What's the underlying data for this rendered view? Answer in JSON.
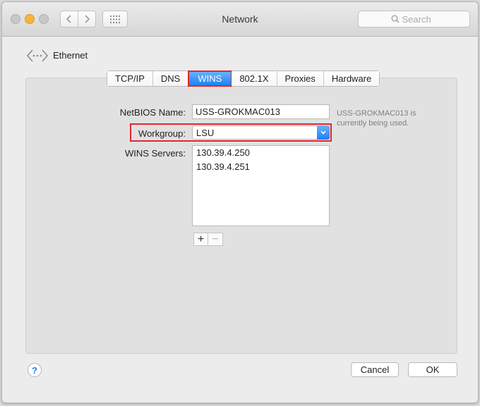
{
  "window": {
    "title": "Network",
    "search_placeholder": "Search"
  },
  "interface": {
    "name": "Ethernet",
    "icon": "ethernet-arrows-icon"
  },
  "tabs": [
    {
      "label": "TCP/IP",
      "active": false
    },
    {
      "label": "DNS",
      "active": false
    },
    {
      "label": "WINS",
      "active": true
    },
    {
      "label": "802.1X",
      "active": false
    },
    {
      "label": "Proxies",
      "active": false
    },
    {
      "label": "Hardware",
      "active": false
    }
  ],
  "form": {
    "netbios_label": "NetBIOS Name:",
    "netbios_value": "USS-GROKMAC013",
    "netbios_note_line1": "USS-GROKMAC013 is",
    "netbios_note_line2": "currently being used.",
    "workgroup_label": "Workgroup:",
    "workgroup_value": "LSU",
    "wins_label": "WINS Servers:",
    "wins_servers": [
      "130.39.4.250",
      "130.39.4.251"
    ],
    "add_symbol": "+",
    "remove_symbol": "−"
  },
  "footer": {
    "help_symbol": "?",
    "cancel_label": "Cancel",
    "ok_label": "OK"
  },
  "colors": {
    "accent": "#1a7ff5",
    "highlight": "#e0282e",
    "minimize": "#f5b53a"
  }
}
